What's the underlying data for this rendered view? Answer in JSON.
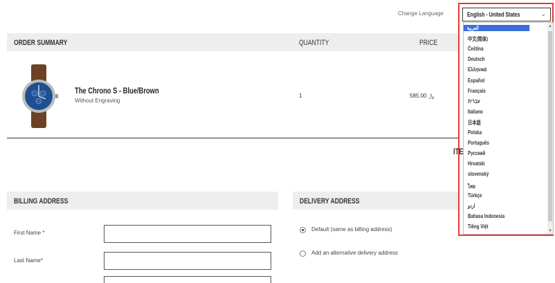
{
  "language": {
    "label": "Change Language",
    "selected": "English - United States",
    "options": [
      "العربية",
      "中文(简体)",
      "Čeština",
      "Deutsch",
      "Ελληνικά",
      "Español",
      "Français",
      "עברית",
      "Italiano",
      "日本語",
      "Polska",
      "Português",
      "Русский",
      "Hrvatski",
      "slovenský",
      "ไทย",
      "Türkçe",
      "اردو",
      "Bahasa Indonesia",
      "Tiếng Việt"
    ],
    "highlighted_index": 0
  },
  "order": {
    "title": "ORDER SUMMARY",
    "col_quantity": "QUANTITY",
    "col_price": "PRICE",
    "item": {
      "name": "The Chrono S - Blue/Brown",
      "variant": "Without Engraving",
      "quantity": "1",
      "price": "﷼ 585.00"
    },
    "cutoff_text": "ITE"
  },
  "billing": {
    "title": "BILLING ADDRESS",
    "fields": [
      {
        "label": "First Name",
        "required_mark": "*"
      },
      {
        "label": "Last Name",
        "required_mark": "*"
      }
    ]
  },
  "delivery": {
    "title": "DELIVERY ADDRESS",
    "options": [
      {
        "label": "Default (same as billing address)",
        "checked": true
      },
      {
        "label": "Add an alternative delivery address",
        "checked": false
      }
    ]
  },
  "colors": {
    "highlight": "#3d6dd6",
    "frame": "#e53935",
    "header_bg": "#eeeeee"
  }
}
